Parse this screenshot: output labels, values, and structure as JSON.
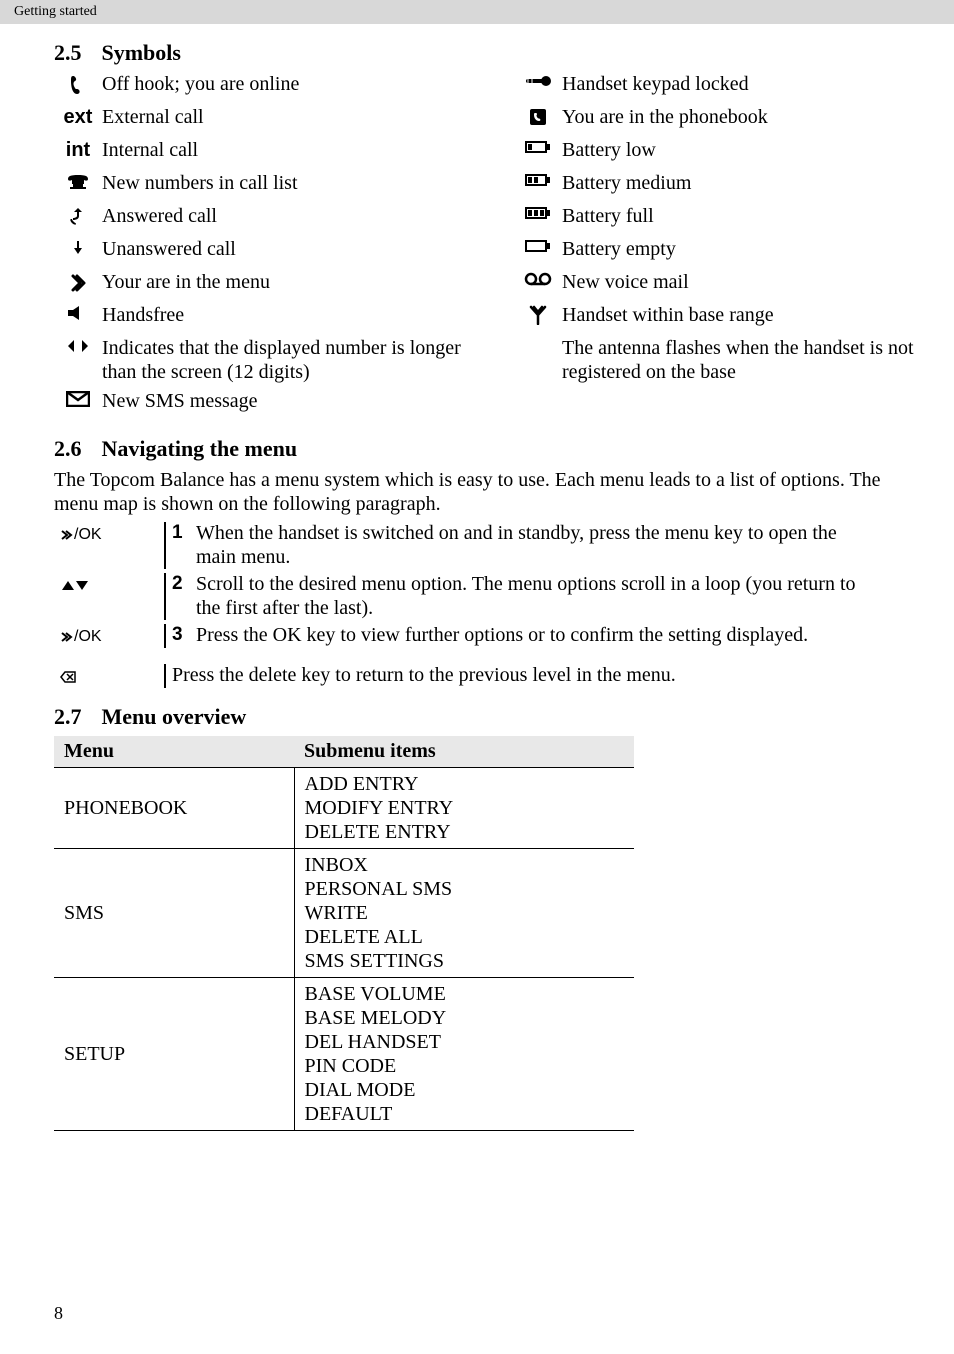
{
  "header": {
    "breadcrumb": "Getting started"
  },
  "sections": {
    "symbols": {
      "number": "2.5",
      "title": "Symbols",
      "rows_left": [
        {
          "name": "off-hook-icon",
          "desc": "Off hook; you are online"
        },
        {
          "name": "ext-text-icon",
          "desc": "External call"
        },
        {
          "name": "int-text-icon",
          "desc": "Internal call"
        },
        {
          "name": "new-numbers-icon",
          "desc": "New numbers in call list"
        },
        {
          "name": "answered-call-icon",
          "desc": "Answered call"
        },
        {
          "name": "unanswered-call-icon",
          "desc": "Unanswered call"
        },
        {
          "name": "menu-icon",
          "desc": "Your are in the menu"
        },
        {
          "name": "handsfree-icon",
          "desc": "Handsfree"
        },
        {
          "name": "scroll-arrows-icon",
          "desc": "Indicates that the displayed number is longer than the screen (12 digits)"
        },
        {
          "name": "envelope-icon",
          "desc": "New SMS message"
        }
      ],
      "rows_right": [
        {
          "name": "keypad-lock-icon",
          "desc": "Handset keypad locked"
        },
        {
          "name": "phonebook-icon",
          "desc": "You are in the phonebook"
        },
        {
          "name": "battery-low-icon",
          "desc": "Battery low"
        },
        {
          "name": "battery-medium-icon",
          "desc": "Battery medium"
        },
        {
          "name": "battery-full-icon",
          "desc": "Battery full"
        },
        {
          "name": "battery-empty-icon",
          "desc": "Battery empty"
        },
        {
          "name": "voicemail-icon",
          "desc": "New voice mail"
        },
        {
          "name": "antenna-icon",
          "desc": "Handset within base range"
        },
        {
          "name": "blank-icon",
          "desc": "The antenna flashes when the handset is not registered on the base"
        }
      ]
    },
    "navigating": {
      "number": "2.6",
      "title": "Navigating the menu",
      "intro": "The Topcom Balance has a menu system which is easy to use. Each menu leads to a list of options. The menu map is shown on the following paragraph.",
      "steps": [
        {
          "key_name": "menu-ok-key",
          "key_text": "/OK",
          "num": "1",
          "text": "When the handset is switched on and in standby, press the menu key to open the main menu."
        },
        {
          "key_name": "up-down-key",
          "key_text": "",
          "num": "2",
          "text": "Scroll to the desired menu option. The menu options scroll in a loop (you return to the first after the last)."
        },
        {
          "key_name": "menu-ok-key",
          "key_text": "/OK",
          "num": "3",
          "text": "Press the OK key to view further options or to confirm the setting displayed."
        }
      ],
      "last_step": {
        "key_name": "delete-key",
        "key_text": "",
        "text": "Press the delete key to return to the previous level in the menu."
      }
    },
    "overview": {
      "number": "2.7",
      "title": "Menu overview",
      "table": {
        "headers": [
          "Menu",
          "Submenu items"
        ],
        "rows": [
          {
            "menu": "PHONEBOOK",
            "sub": "ADD ENTRY\nMODIFY ENTRY\nDELETE ENTRY"
          },
          {
            "menu": "SMS",
            "sub": "INBOX\nPERSONAL SMS\nWRITE\nDELETE ALL\nSMS SETTINGS"
          },
          {
            "menu": "SETUP",
            "sub": "BASE VOLUME\nBASE MELODY\nDEL HANDSET\nPIN CODE\nDIAL MODE\nDEFAULT"
          }
        ]
      }
    }
  },
  "page_number": "8",
  "icon_text": {
    "ext": "ext",
    "int": "int"
  }
}
